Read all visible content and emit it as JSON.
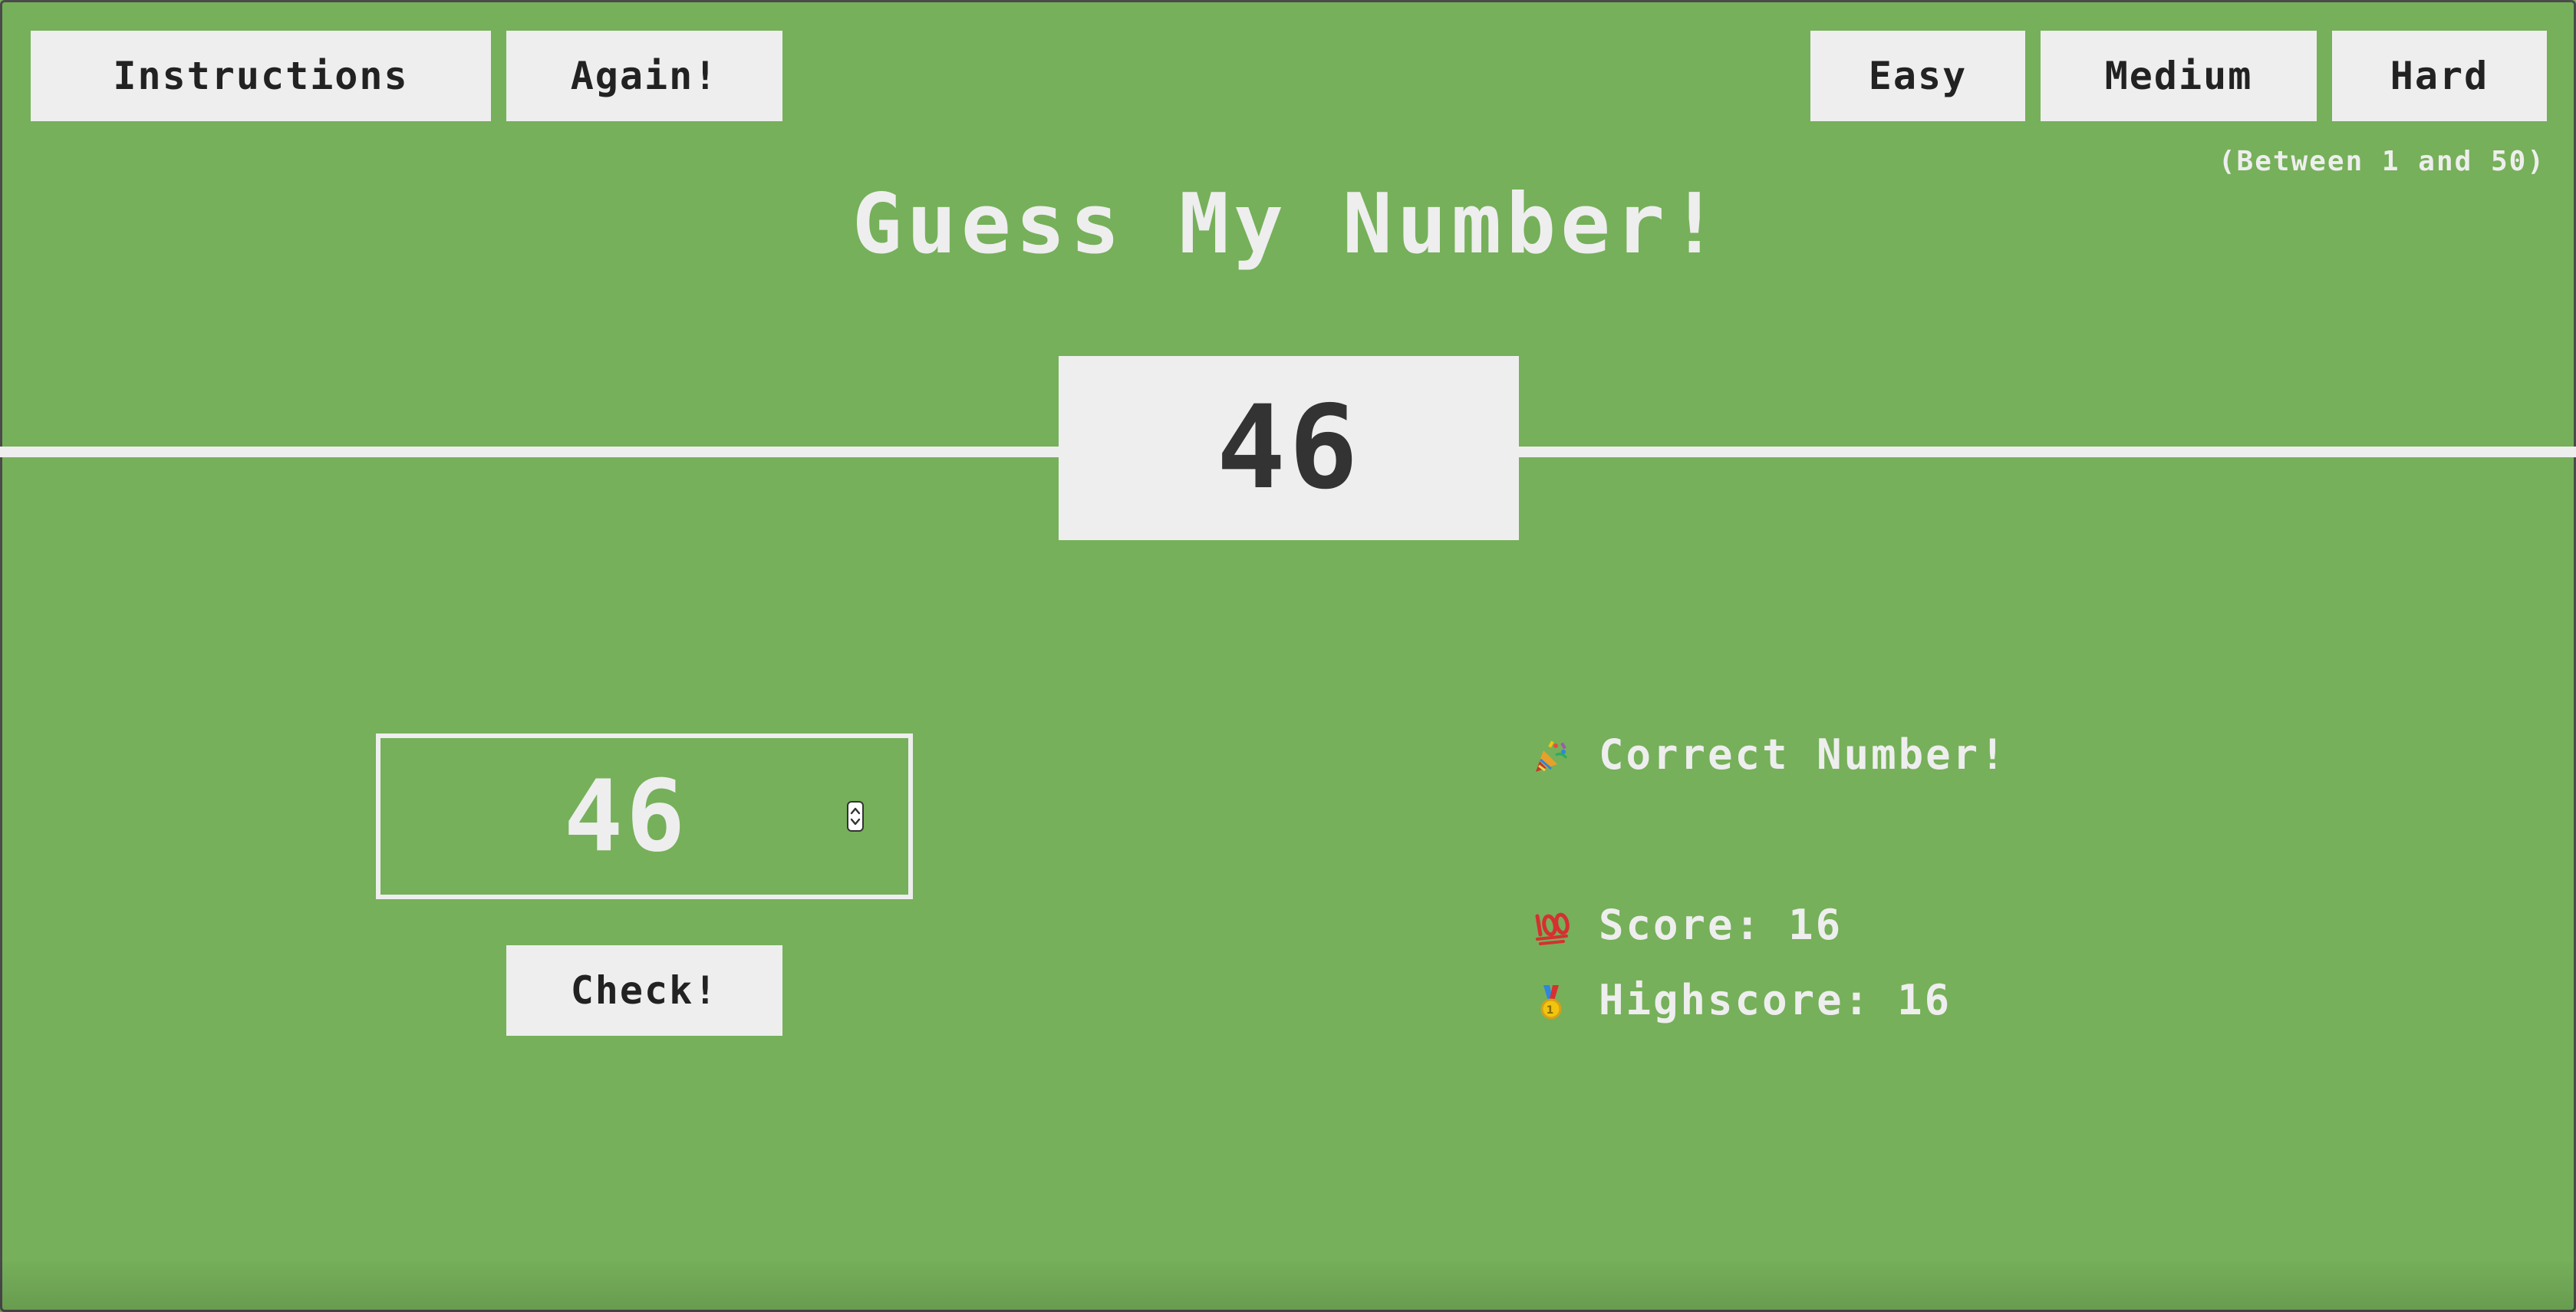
{
  "controls": {
    "instructions_label": "Instructions",
    "again_label": "Again!",
    "check_label": "Check!"
  },
  "difficulty": {
    "easy_label": "Easy",
    "medium_label": "Medium",
    "hard_label": "Hard",
    "range_hint": "(Between 1 and 50)"
  },
  "game": {
    "title": "Guess My Number!",
    "secret_number": "46",
    "guess_value": "46",
    "message": "Correct Number!",
    "score_label": "Score:",
    "score": "16",
    "highscore_label": "Highscore:",
    "highscore": "16"
  },
  "icons": {
    "message_icon": "party-popper-icon",
    "score_icon": "hundred-points-icon",
    "highscore_icon": "medal-icon"
  },
  "colors": {
    "background": "#76b05a",
    "foreground": "#eeeeee",
    "button_text": "#222222",
    "number_text": "#333333"
  }
}
